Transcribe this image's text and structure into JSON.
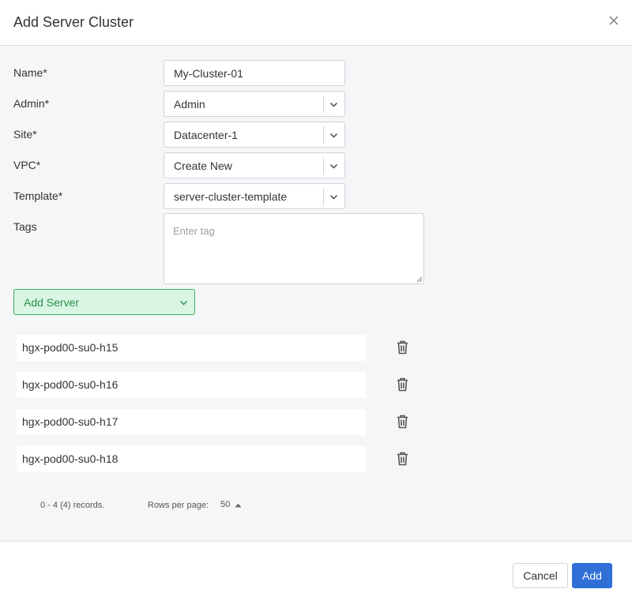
{
  "dialog": {
    "title": "Add Server Cluster",
    "close_icon": "close-icon"
  },
  "form": {
    "name_label": "Name*",
    "name_value": "My-Cluster-01",
    "admin_label": "Admin*",
    "admin_value": "Admin",
    "site_label": "Site*",
    "site_value": "Datacenter-1",
    "vpc_label": "VPC*",
    "vpc_value": "Create New",
    "template_label": "Template*",
    "template_value": "server-cluster-template",
    "tags_label": "Tags",
    "tags_placeholder": "Enter tag"
  },
  "add_server": {
    "label": "Add Server",
    "color_bg": "#d9f5e3",
    "color_border": "#3fae62"
  },
  "servers": [
    "hgx-pod00-su0-h15",
    "hgx-pod00-su0-h16",
    "hgx-pod00-su0-h17",
    "hgx-pod00-su0-h18"
  ],
  "pagination": {
    "records": "0 - 4 (4) records.",
    "rows_per_page_label": "Rows per page:",
    "rows_per_page_value": "50"
  },
  "footer": {
    "cancel_label": "Cancel",
    "add_label": "Add",
    "add_color": "#2f6fd6"
  }
}
